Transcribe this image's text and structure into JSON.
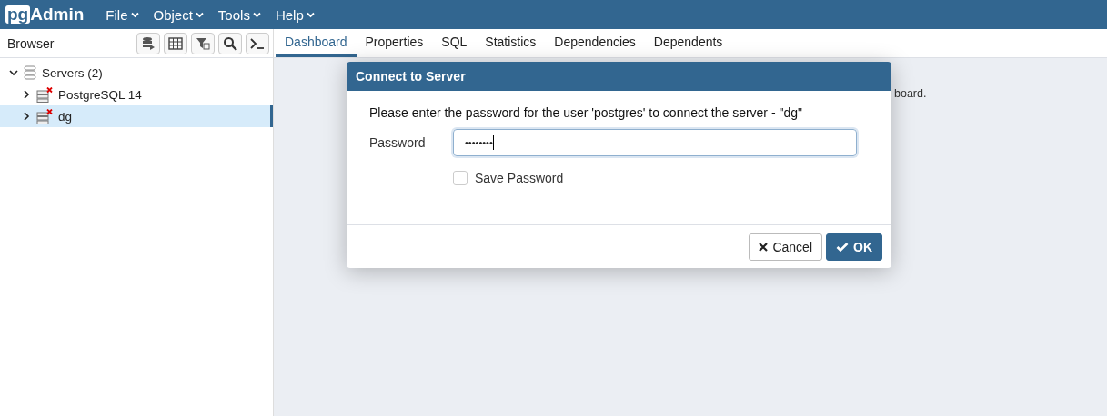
{
  "app": {
    "logo_prefix": "pg",
    "logo_name": "Admin",
    "menus": [
      {
        "label": "File"
      },
      {
        "label": "Object"
      },
      {
        "label": "Tools"
      },
      {
        "label": "Help"
      }
    ]
  },
  "browser": {
    "title": "Browser",
    "tree": [
      {
        "label": "Servers (2)",
        "kind": "group",
        "expanded": true,
        "selected": false,
        "children": [
          {
            "label": "PostgreSQL 14",
            "kind": "server",
            "expanded": false,
            "selected": false
          },
          {
            "label": "dg",
            "kind": "server",
            "expanded": false,
            "selected": true
          }
        ]
      }
    ]
  },
  "tabs": [
    {
      "label": "Dashboard",
      "selected": true
    },
    {
      "label": "Properties",
      "selected": false
    },
    {
      "label": "SQL",
      "selected": false
    },
    {
      "label": "Statistics",
      "selected": false
    },
    {
      "label": "Dependencies",
      "selected": false
    },
    {
      "label": "Dependents",
      "selected": false
    }
  ],
  "background_text": "board.",
  "dialog": {
    "title": "Connect to Server",
    "message": "Please enter the password for the user 'postgres' to connect the server - \"dg\"",
    "password_label": "Password",
    "password_value": "••••••••",
    "save_password": {
      "label": "Save Password",
      "checked": false
    },
    "buttons": [
      {
        "label": "Cancel",
        "kind": "cancel"
      },
      {
        "label": "OK",
        "kind": "ok"
      }
    ]
  }
}
